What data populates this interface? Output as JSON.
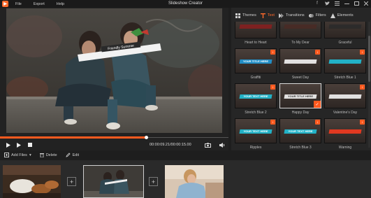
{
  "window": {
    "title": "Slideshow Creator",
    "menu": [
      "File",
      "Export",
      "Help"
    ],
    "controls": [
      "facebook-icon",
      "twitter-icon",
      "menu-icon",
      "minimize-icon",
      "maximize-icon",
      "close-icon"
    ]
  },
  "preview": {
    "caption_title": "Friendly Summer",
    "caption_sub": "",
    "current_time": "00:00:09.21",
    "total_time": "00:00:15.00",
    "progress": 0.64
  },
  "tabs": [
    {
      "label": "Themes",
      "icon": "themes-icon",
      "active": false
    },
    {
      "label": "Text",
      "icon": "text-icon",
      "active": true
    },
    {
      "label": "Transitions",
      "icon": "transitions-icon",
      "active": false
    },
    {
      "label": "Filters",
      "icon": "filters-icon",
      "active": false
    },
    {
      "label": "Elements",
      "icon": "elements-icon",
      "active": false
    }
  ],
  "text_styles": [
    {
      "label": "Heart to Heart",
      "thumb_text": "",
      "download": false,
      "selected": false,
      "accent": "#8a1f1f"
    },
    {
      "label": "To My Dear",
      "thumb_text": "",
      "download": false,
      "selected": false,
      "accent": "#4a2a25"
    },
    {
      "label": "Graceful",
      "thumb_text": "",
      "download": false,
      "selected": false,
      "accent": "#2a2a2a"
    },
    {
      "label": "Graffiti",
      "thumb_text": "YOUR TITLE HERE",
      "download": true,
      "selected": false,
      "accent": "#1f9fe0"
    },
    {
      "label": "Sweet Day",
      "thumb_text": "",
      "download": true,
      "selected": false,
      "accent": "#ffffff"
    },
    {
      "label": "Stretch Blue 1",
      "thumb_text": "",
      "download": true,
      "selected": false,
      "accent": "#1ec8e0"
    },
    {
      "label": "Stretch Blue 2",
      "thumb_text": "YOUR TEXT HERE",
      "download": true,
      "selected": false,
      "accent": "#1ec8e0"
    },
    {
      "label": "Happy Day",
      "thumb_text": "YOUR TITLE HERE",
      "download": false,
      "selected": true,
      "accent": "#ffffff"
    },
    {
      "label": "Valentine's Day",
      "thumb_text": "",
      "download": true,
      "selected": false,
      "accent": "#ffffff"
    },
    {
      "label": "Ripples",
      "thumb_text": "YOUR TEXT HERE",
      "download": true,
      "selected": false,
      "accent": "#1ec8e0"
    },
    {
      "label": "Stretch Blue 3",
      "thumb_text": "YOUR TEXT HERE",
      "download": true,
      "selected": false,
      "accent": "#1ec8e0"
    },
    {
      "label": "Warning",
      "thumb_text": "",
      "download": true,
      "selected": false,
      "accent": "#ff3b1f"
    }
  ],
  "toolbar": {
    "add_files": "Add Files",
    "delete": "Delete",
    "edit": "Edit"
  },
  "timeline": {
    "clips": [
      "clip-shoes",
      "clip-friends",
      "clip-woman"
    ],
    "selected_index": 1
  },
  "colors": {
    "accent": "#ff5a1f",
    "background": "#1e1e1e",
    "panel": "#262626"
  }
}
